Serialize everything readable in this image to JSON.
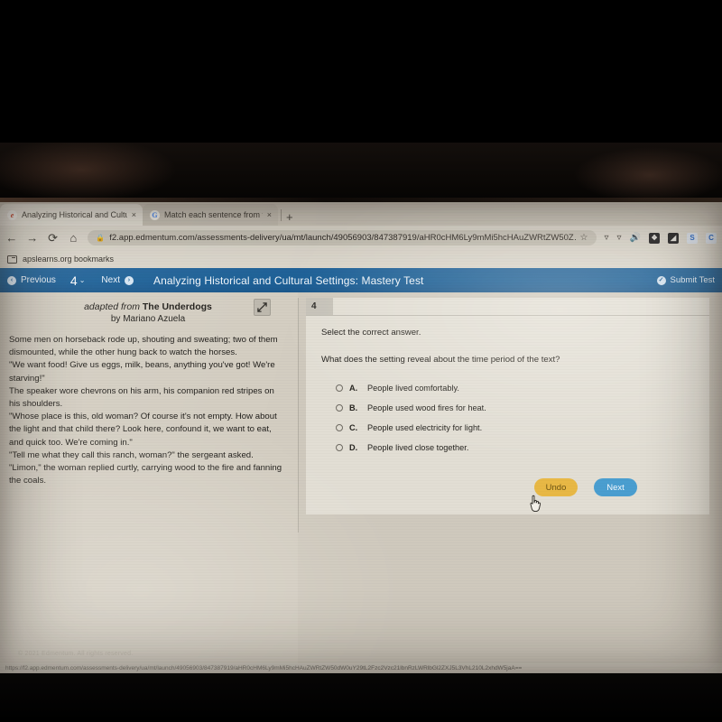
{
  "browser": {
    "tabs": [
      {
        "title": "Analyzing Historical and Cultura",
        "favicon": "edmentum-e-icon",
        "close": "×",
        "active": true
      },
      {
        "title": "Match each sentence from the p",
        "favicon": "google-g-icon",
        "close": "×",
        "active": false
      }
    ],
    "new_tab_label": "+",
    "nav": {
      "back": "←",
      "forward": "→",
      "reload": "⟳",
      "home": "⌂"
    },
    "omnibox": {
      "lock": "🔒",
      "url": "f2.app.edmentum.com/assessments-delivery/ua/mt/launch/49056903/847387919/aHR0cHM6Ly9mMi5hcHAuZWRtZW50Z…",
      "star": "☆"
    },
    "toolbar_icons": [
      "shield-icon",
      "shield-icon",
      "speaker-icon"
    ],
    "extensions": [
      {
        "name": "puzzle-extension-icon",
        "glyph": "❖",
        "style": "dark"
      },
      {
        "name": "screenshot-extension-icon",
        "glyph": "◢",
        "style": "dark"
      },
      {
        "name": "skype-extension-icon",
        "glyph": "S",
        "style": "blue"
      },
      {
        "name": "clever-extension-icon",
        "glyph": "C",
        "style": "blue"
      }
    ],
    "bookmarks_bar": {
      "folder_label": "apslearns.org bookmarks"
    }
  },
  "appbar": {
    "previous_label": "Previous",
    "question_number": "4",
    "caret": "⌄",
    "next_label": "Next",
    "title": "Analyzing Historical and Cultural Settings: Mastery Test",
    "submit_label": "Submit Test"
  },
  "passage": {
    "attribution_prefix": "adapted from ",
    "title": "The Underdogs",
    "byline": "by Mariano Azuela",
    "expand_icon": "⤡",
    "paragraphs": [
      "Some men on horseback rode up, shouting and sweating; two of them dismounted, while the other hung back to watch the horses.",
      "\"We want food! Give us eggs, milk, beans, anything you've got! We're starving!\"",
      "The speaker wore chevrons on his arm, his companion red stripes on his shoulders.",
      "\"Whose place is this, old woman? Of course it's not empty. How about the light and that child there? Look here, confound it, we want to eat, and quick too. We're coming in.\"",
      "\"Tell me what they call this ranch, woman?\" the sergeant asked.",
      "\"Limon,\" the woman replied curtly, carrying wood to the fire and fanning the coals."
    ]
  },
  "question": {
    "number": "4",
    "lead": "Select the correct answer.",
    "prompt": "What does the setting reveal about the time period of the text?",
    "choices": [
      {
        "letter": "A.",
        "text": "People lived comfortably.",
        "selected": false
      },
      {
        "letter": "B.",
        "text": "People used wood fires for heat.",
        "selected": false
      },
      {
        "letter": "C.",
        "text": "People used electricity for light.",
        "selected": false
      },
      {
        "letter": "D.",
        "text": "People lived close together.",
        "selected": false
      }
    ],
    "undo_label": "Undo",
    "next_label": "Next"
  },
  "footer": {
    "copyright": "© 2021 Edmentum. All rights reserved.",
    "status_url": "https://f2.app.edmentum.com/assessments-delivery/ua/mt/launch/49056903/847387919/aHR0cHM6Ly9mMi5hcHAuZWRtZW50dW0uY29tL2Fzc2Vzc21lbnRzLWRlbGl2ZXJ5L3VhL210L2xhdW5jaA=="
  },
  "colors": {
    "appbar_blue": "#1a5f97",
    "undo_amber": "#e8b845",
    "next_blue": "#4a9ed0",
    "screen_paper": "#cfc9bd"
  }
}
